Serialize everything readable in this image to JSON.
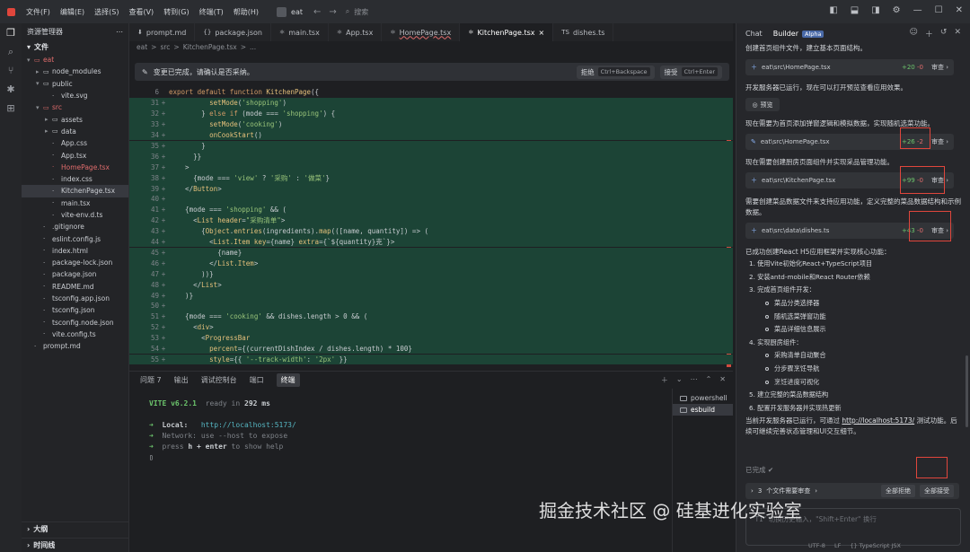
{
  "titlebar": {
    "menu": [
      "文件(F)",
      "编辑(E)",
      "选择(S)",
      "查看(V)",
      "转到(G)",
      "终端(T)",
      "帮助(H)"
    ],
    "project": "eat",
    "search_placeholder": "搜索"
  },
  "explorer": {
    "title": "资源管理器",
    "section": "文件",
    "outline": "大纲",
    "timeline": "时间线",
    "tree": [
      {
        "label": "eat",
        "depth": 0,
        "arrow": "▾",
        "icon": "folder",
        "err": true
      },
      {
        "label": "node_modules",
        "depth": 1,
        "arrow": "▸",
        "icon": "folder"
      },
      {
        "label": "public",
        "depth": 1,
        "arrow": "▾",
        "icon": "folder"
      },
      {
        "label": "vite.svg",
        "depth": 2,
        "arrow": "",
        "icon": "file"
      },
      {
        "label": "src",
        "depth": 1,
        "arrow": "▾",
        "icon": "folder",
        "err": true
      },
      {
        "label": "assets",
        "depth": 2,
        "arrow": "▸",
        "icon": "folder"
      },
      {
        "label": "data",
        "depth": 2,
        "arrow": "▸",
        "icon": "folder"
      },
      {
        "label": "App.css",
        "depth": 2,
        "arrow": "",
        "icon": "file"
      },
      {
        "label": "App.tsx",
        "depth": 2,
        "arrow": "",
        "icon": "file"
      },
      {
        "label": "HomePage.tsx",
        "depth": 2,
        "arrow": "",
        "icon": "file",
        "err": true
      },
      {
        "label": "index.css",
        "depth": 2,
        "arrow": "",
        "icon": "file"
      },
      {
        "label": "KitchenPage.tsx",
        "depth": 2,
        "arrow": "",
        "icon": "file",
        "sel": true
      },
      {
        "label": "main.tsx",
        "depth": 2,
        "arrow": "",
        "icon": "file"
      },
      {
        "label": "vite-env.d.ts",
        "depth": 2,
        "arrow": "",
        "icon": "file"
      },
      {
        "label": ".gitignore",
        "depth": 1,
        "arrow": "",
        "icon": "file"
      },
      {
        "label": "eslint.config.js",
        "depth": 1,
        "arrow": "",
        "icon": "file"
      },
      {
        "label": "index.html",
        "depth": 1,
        "arrow": "",
        "icon": "file"
      },
      {
        "label": "package-lock.json",
        "depth": 1,
        "arrow": "",
        "icon": "file"
      },
      {
        "label": "package.json",
        "depth": 1,
        "arrow": "",
        "icon": "file"
      },
      {
        "label": "README.md",
        "depth": 1,
        "arrow": "",
        "icon": "file"
      },
      {
        "label": "tsconfig.app.json",
        "depth": 1,
        "arrow": "",
        "icon": "file"
      },
      {
        "label": "tsconfig.json",
        "depth": 1,
        "arrow": "",
        "icon": "file"
      },
      {
        "label": "tsconfig.node.json",
        "depth": 1,
        "arrow": "",
        "icon": "file"
      },
      {
        "label": "vite.config.ts",
        "depth": 1,
        "arrow": "",
        "icon": "file"
      },
      {
        "label": "prompt.md",
        "depth": 0,
        "arrow": "",
        "icon": "file"
      }
    ]
  },
  "tabs": [
    {
      "label": "prompt.md",
      "icon": "⬇"
    },
    {
      "label": "package.json",
      "icon": "{}"
    },
    {
      "label": "main.tsx",
      "icon": "⚛"
    },
    {
      "label": "App.tsx",
      "icon": "⚛"
    },
    {
      "label": "HomePage.tsx",
      "icon": "⚛",
      "err": true
    },
    {
      "label": "KitchenPage.tsx",
      "icon": "⚛",
      "active": true,
      "close": "×"
    },
    {
      "label": "dishes.ts",
      "icon": "TS"
    }
  ],
  "breadcrumb": [
    "eat",
    ">",
    "src",
    ">",
    "KitchenPage.tsx",
    ">",
    "..."
  ],
  "banner": {
    "text": "变更已完成，请确认是否采纳。",
    "reject_label": "拒绝",
    "reject_kbd": "Ctrl+Backspace",
    "accept_label": "接受",
    "accept_kbd": "Ctrl+Enter"
  },
  "code": [
    {
      "ln": "6",
      "gm": "",
      "added": false,
      "html": "<span class='kw'>export default function</span> <span class='fn'>KitchenPage</span>({"
    },
    {
      "ln": "31",
      "gm": "+",
      "added": true,
      "html": "          <span class='fn'>setMode</span>(<span class='str'>'shopping'</span>)"
    },
    {
      "ln": "32",
      "gm": "+",
      "added": true,
      "html": "        } <span class='kw'>else if</span> (mode === <span class='str'>'shopping'</span>) {"
    },
    {
      "ln": "33",
      "gm": "+",
      "added": true,
      "html": "          <span class='fn'>setMode</span>(<span class='str'>'cooking'</span>)"
    },
    {
      "ln": "34",
      "gm": "+",
      "added": true,
      "html": "          <span class='fn'>onCookStart</span>()"
    },
    {
      "ln": "35",
      "gm": "+",
      "added": true,
      "html": "        }"
    },
    {
      "ln": "36",
      "gm": "+",
      "added": true,
      "html": "      }}"
    },
    {
      "ln": "37",
      "gm": "+",
      "added": true,
      "html": "    >"
    },
    {
      "ln": "38",
      "gm": "+",
      "added": true,
      "html": "      {mode === <span class='str'>'view'</span> ? <span class='str'>'采购'</span> : <span class='str'>'做菜'</span>}"
    },
    {
      "ln": "39",
      "gm": "+",
      "added": true,
      "html": "    &lt;/<span class='tag'>Button</span>&gt;"
    },
    {
      "ln": "40",
      "gm": "+",
      "added": true,
      "html": ""
    },
    {
      "ln": "41",
      "gm": "+",
      "added": true,
      "html": "    {mode === <span class='str'>'shopping'</span> &amp;&amp; ("
    },
    {
      "ln": "42",
      "gm": "+",
      "added": true,
      "html": "      &lt;<span class='tag'>List</span> <span class='attr'>header</span>=<span class='str'>\"采购清单\"</span>&gt;"
    },
    {
      "ln": "43",
      "gm": "+",
      "added": true,
      "html": "        {<span class='fn'>Object</span>.<span class='fn'>entries</span>(ingredients).<span class='fn'>map</span>(([name, quantity]) =&gt; ("
    },
    {
      "ln": "44",
      "gm": "+",
      "added": true,
      "html": "          &lt;<span class='tag'>List.Item</span> <span class='attr'>key</span>={name} <span class='attr'>extra</span>={`${quantity}克`}&gt;"
    },
    {
      "ln": "45",
      "gm": "+",
      "added": true,
      "html": "            {name}"
    },
    {
      "ln": "46",
      "gm": "+",
      "added": true,
      "html": "          &lt;/<span class='tag'>List.Item</span>&gt;"
    },
    {
      "ln": "47",
      "gm": "+",
      "added": true,
      "html": "        ))}"
    },
    {
      "ln": "48",
      "gm": "+",
      "added": true,
      "html": "      &lt;/<span class='tag'>List</span>&gt;"
    },
    {
      "ln": "49",
      "gm": "+",
      "added": true,
      "html": "    )}"
    },
    {
      "ln": "50",
      "gm": "+",
      "added": true,
      "html": ""
    },
    {
      "ln": "51",
      "gm": "+",
      "added": true,
      "html": "    {mode === <span class='str'>'cooking'</span> &amp;&amp; dishes.length &gt; 0 &amp;&amp; ("
    },
    {
      "ln": "52",
      "gm": "+",
      "added": true,
      "html": "      &lt;<span class='tag'>div</span>&gt;"
    },
    {
      "ln": "53",
      "gm": "+",
      "added": true,
      "html": "        &lt;<span class='tag'>ProgressBar</span>"
    },
    {
      "ln": "54",
      "gm": "+",
      "added": true,
      "html": "          <span class='attr'>percent</span>={(currentDishIndex / dishes.length) * 100}"
    },
    {
      "ln": "55",
      "gm": "+",
      "added": true,
      "html": "          <span class='attr'>style</span>={{ <span class='str'>'--track-width'</span>: <span class='str'>'2px'</span> }}"
    }
  ],
  "terminal_tabs": [
    "问题 7",
    "输出",
    "调试控制台",
    "端口",
    "终端"
  ],
  "terminal": {
    "vite": "VITE",
    "version": "v6.2.1",
    "ready": "ready in",
    "ms": "292 ms",
    "local_label": "Local:",
    "local_url": "http://localhost:5173/",
    "network": "Network: use --host to expose",
    "help_pre": "press ",
    "help_key": "h + enter",
    "help_post": " to show help",
    "cursor": "▯"
  },
  "terminal_list": [
    {
      "label": "powershell",
      "active": false
    },
    {
      "label": "esbuild",
      "active": true
    }
  ],
  "chat": {
    "tab_chat": "Chat",
    "tab_builder": "Builder",
    "alpha": "Alpha",
    "msg1": "创建首页组件文件，建立基本页面结构。",
    "card1": {
      "path": "eat\\src\\HomePage.tsx",
      "add": "+20",
      "del": "-0",
      "rev": "审查 ›"
    },
    "msg2": "开发服务器已运行，现在可以打开预览查看应用效果。",
    "preview": "预览",
    "msg3": "现在需要为首页添加弹窗逻辑和模拟数据，实现随机选菜功能。",
    "card2": {
      "path": "eat\\src\\HomePage.tsx",
      "add": "+26",
      "del": "-2",
      "rev": "审查 ›"
    },
    "msg4": "现在需要创建厨房页面组件并实现采品管理功能。",
    "card3": {
      "path": "eat\\src\\KitchenPage.tsx",
      "add": "+99",
      "del": "-0",
      "rev": "审查 ›"
    },
    "msg5": "需要创建菜品数据文件来支持应用功能，定义完整的菜品数据结构和示例数据。",
    "card4": {
      "path": "eat\\src\\data\\dishes.ts",
      "add": "+43",
      "del": "-0",
      "rev": "审查 ›"
    },
    "msg6": "已成功创建React H5应用框架并实现核心功能：",
    "list": [
      {
        "t": "1. 使用Vite初始化React+TypeScript项目",
        "sub": false
      },
      {
        "t": "2. 安装antd-mobile和React Router依赖",
        "sub": false
      },
      {
        "t": "3. 完成首页组件开发：",
        "sub": false
      },
      {
        "t": "菜品分类选择器",
        "sub": true
      },
      {
        "t": "随机选菜弹窗功能",
        "sub": true
      },
      {
        "t": "菜品详细信息展示",
        "sub": true
      },
      {
        "t": "4. 实现厨房组件：",
        "sub": false
      },
      {
        "t": "采购清单自动聚合",
        "sub": true
      },
      {
        "t": "分步骤烹饪导航",
        "sub": true
      },
      {
        "t": "烹饪进度可视化",
        "sub": true
      },
      {
        "t": "5. 建立完整的菜品数据结构",
        "sub": false
      },
      {
        "t": "6. 配置开发服务器并实现热更新",
        "sub": false
      }
    ],
    "msg7_pre": "当前开发服务器已运行，可通过 ",
    "msg7_link": "http://localhost:5173/",
    "msg7_post": " 测试功能。后续可继续完善状态管理和UI交互细节。",
    "done": "已完成 ✔",
    "review_count": "3",
    "review_label": "个文件需要审查",
    "reject_all": "全部拒绝",
    "accept_all": "全部接受",
    "input_placeholder": "\"T1\" 切换历史输入，\"Shift+Enter\" 换行"
  },
  "watermark": "掘金技术社区 @ 硅基进化实验室",
  "status": [
    "UTF-8",
    "LF",
    "{} TypeScript JSX"
  ]
}
